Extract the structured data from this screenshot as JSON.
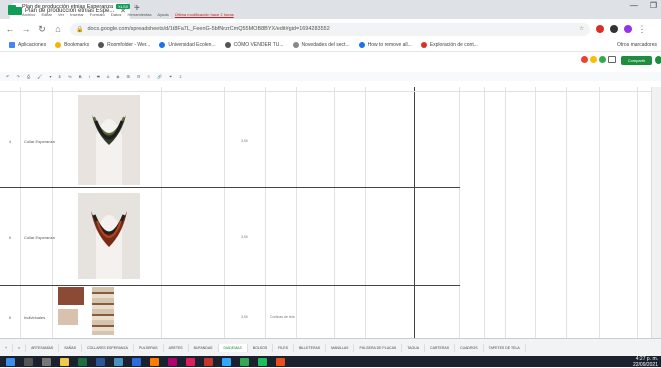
{
  "browser": {
    "tab_title": "Plan de producción etnias Espe...",
    "url": "docs.google.com/spreadsheets/d/1t8Fa7L_FeenG-5bfNrzrCmQ55MOB8BYX/edit#gid=1694283552",
    "bookmarks": [
      "Aplicaciones",
      "Bookmarks",
      "Roomfolder - Wer...",
      "Universidad Ecolen...",
      "CÓMO VENDER TU...",
      "Novedades del sect...",
      "How to remove all...",
      "Exploración de cont..."
    ],
    "other_bookmarks": "Otros marcadores"
  },
  "sheet": {
    "title": "Plan de producción etnias Esperanza",
    "badge": "XLSX",
    "menu": [
      "Archivo",
      "Editar",
      "Ver",
      "Insertar",
      "Formato",
      "Datos",
      "Herramientas",
      "Ayuda"
    ],
    "last_edit": "Última modificación hace 2 horas",
    "share_label": "Compartir",
    "rows": [
      {
        "num": "4",
        "label": "Collar Esperanza",
        "value": "3,50"
      },
      {
        "num": "5",
        "label": "Collar Esperanza",
        "value": "3,50"
      },
      {
        "num": "6",
        "label": "Individuales",
        "value": "3,50",
        "extra": "Cortinas de tela"
      }
    ],
    "tabs": [
      "ARTESANÍAS",
      "SAÑAS",
      "COLLARES ESPERANZA",
      "PULSERAS",
      "ARETES",
      "BUFANDAS",
      "DIADEMAS",
      "BOLSOS",
      "FILES",
      "BILLETERAS",
      "MANILLAS",
      "PULSERA DE PLACAS",
      "TAGUA",
      "CARTERAS",
      "CUADROS",
      "TAPETES DE TELA"
    ]
  },
  "taskbar": {
    "time": "4:27 p. m.",
    "date": "22/09/2021"
  },
  "colors": {
    "sheets_green": "#0f9d58",
    "taskbar": "#1c2130"
  }
}
